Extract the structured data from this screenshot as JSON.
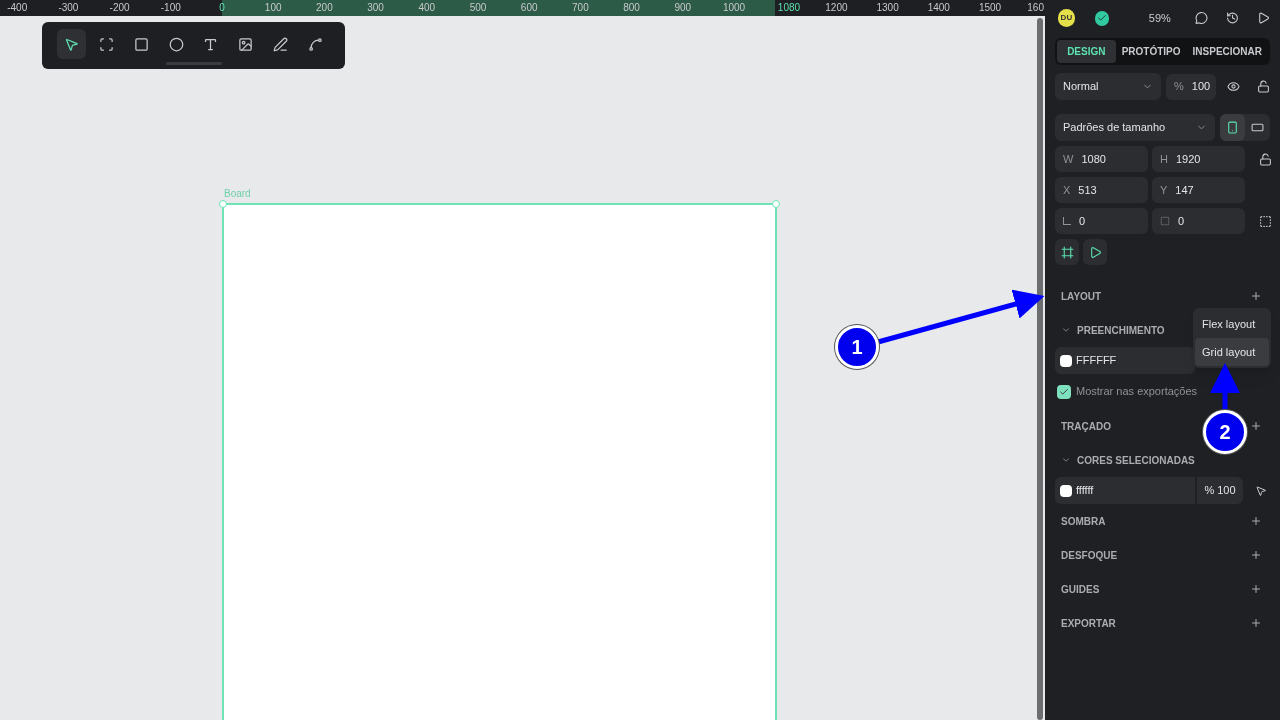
{
  "ruler": {
    "labels": [
      "-400",
      "-300",
      "-200",
      "-100",
      "0",
      "100",
      "200",
      "300",
      "400",
      "500",
      "600",
      "700",
      "800",
      "900",
      "1000",
      "1080",
      "1200",
      "1300",
      "1400",
      "1500",
      "160"
    ]
  },
  "toolbar": {
    "tools": [
      {
        "kind": "pointer",
        "selected": true
      },
      {
        "kind": "board",
        "selected": false
      },
      {
        "kind": "rect",
        "selected": false
      },
      {
        "kind": "ellipse",
        "selected": false
      },
      {
        "kind": "text",
        "selected": false
      },
      {
        "kind": "image",
        "selected": false
      },
      {
        "kind": "pen",
        "selected": false
      },
      {
        "kind": "path",
        "selected": false
      }
    ]
  },
  "board": {
    "label": "Board"
  },
  "header": {
    "avatar": "DU",
    "zoom": "59%"
  },
  "tabs": [
    {
      "label": "DESIGN",
      "selected": true
    },
    {
      "label": "PROTÓTIPO",
      "selected": false
    },
    {
      "label": "INSPECIONAR",
      "selected": false
    }
  ],
  "blend": {
    "value": "Normal",
    "opacity_prefix": "%",
    "opacity": "100"
  },
  "size_preset": {
    "value": "Padrões de tamanho",
    "portrait": true
  },
  "measures": [
    {
      "label": "W",
      "value": "1080"
    },
    {
      "label": "H",
      "value": "1920"
    },
    {
      "label": "X",
      "value": "513"
    },
    {
      "label": "Y",
      "value": "147"
    }
  ],
  "rotation": "0",
  "radius": "0",
  "sections": [
    {
      "kind": "layout",
      "title": "LAYOUT",
      "collapsible": false
    },
    {
      "kind": "fill",
      "title": "PREENCHIMENTO",
      "collapsible": true,
      "hex": "FFFFFF",
      "show_in_exports": {
        "label": "Mostrar nas exportações",
        "checked": true
      }
    },
    {
      "kind": "plain",
      "title": "TRAÇADO",
      "collapsible": false
    },
    {
      "kind": "selected_colors",
      "title": "CORES SELECIONADAS",
      "collapsible": true,
      "hex": "ffffff",
      "opacity": "% 100"
    },
    {
      "kind": "plain",
      "title": "SOMBRA",
      "collapsible": false
    },
    {
      "kind": "plain",
      "title": "DESFOQUE",
      "collapsible": false
    },
    {
      "kind": "plain",
      "title": "GUIDES",
      "collapsible": false
    },
    {
      "kind": "plain",
      "title": "EXPORTAR",
      "collapsible": false
    }
  ],
  "layout_menu": [
    {
      "label": "Flex layout",
      "selected": false
    },
    {
      "label": "Grid layout",
      "selected": true
    }
  ],
  "annotations": [
    "1",
    "2"
  ]
}
